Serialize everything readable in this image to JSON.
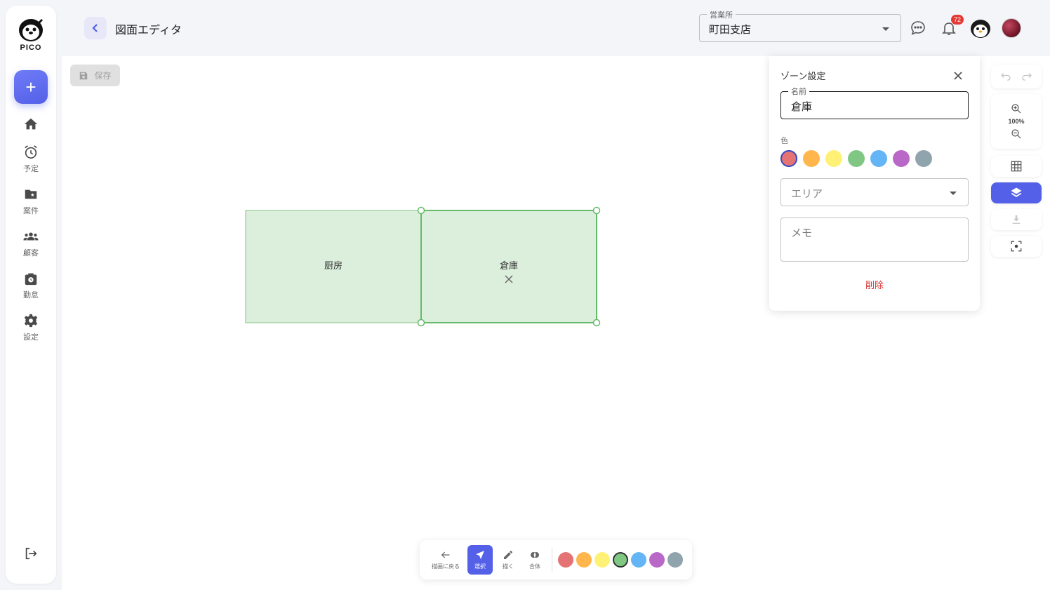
{
  "app": {
    "logo_text": "PICO",
    "page_title": "図面エディタ"
  },
  "sidebar": {
    "items": [
      {
        "label": ""
      },
      {
        "label": "予定"
      },
      {
        "label": "案件"
      },
      {
        "label": "顧客"
      },
      {
        "label": "勤怠"
      },
      {
        "label": "設定"
      }
    ]
  },
  "header": {
    "branch_label": "営業所",
    "branch_value": "町田支店",
    "notification_count": "72"
  },
  "toolbar": {
    "save_label": "保存"
  },
  "zones": [
    {
      "name": "厨房",
      "color": "#dcefdc",
      "stroke": "#a5d6a7",
      "selected": false
    },
    {
      "name": "倉庫",
      "color": "#dcefdc",
      "stroke": "#66bb6a",
      "selected": true
    }
  ],
  "panel": {
    "title": "ゾーン設定",
    "name_label": "名前",
    "name_value": "倉庫",
    "color_label": "色",
    "colors": [
      "#e57373",
      "#ffb74d",
      "#fff176",
      "#81c784",
      "#64b5f6",
      "#ba68c8",
      "#90a4ae"
    ],
    "selected_color_index": 0,
    "area_placeholder": "エリア",
    "memo_placeholder": "メモ",
    "delete_label": "削除"
  },
  "zoom": {
    "level": "100%"
  },
  "bottom_toolbar": {
    "back_label": "描画に戻る",
    "select_label": "選択",
    "draw_label": "描く",
    "merge_label": "合体",
    "colors": [
      "#e57373",
      "#ffb74d",
      "#fff176",
      "#81c784",
      "#64b5f6",
      "#ba68c8",
      "#90a4ae"
    ],
    "selected_color_index": 3
  }
}
